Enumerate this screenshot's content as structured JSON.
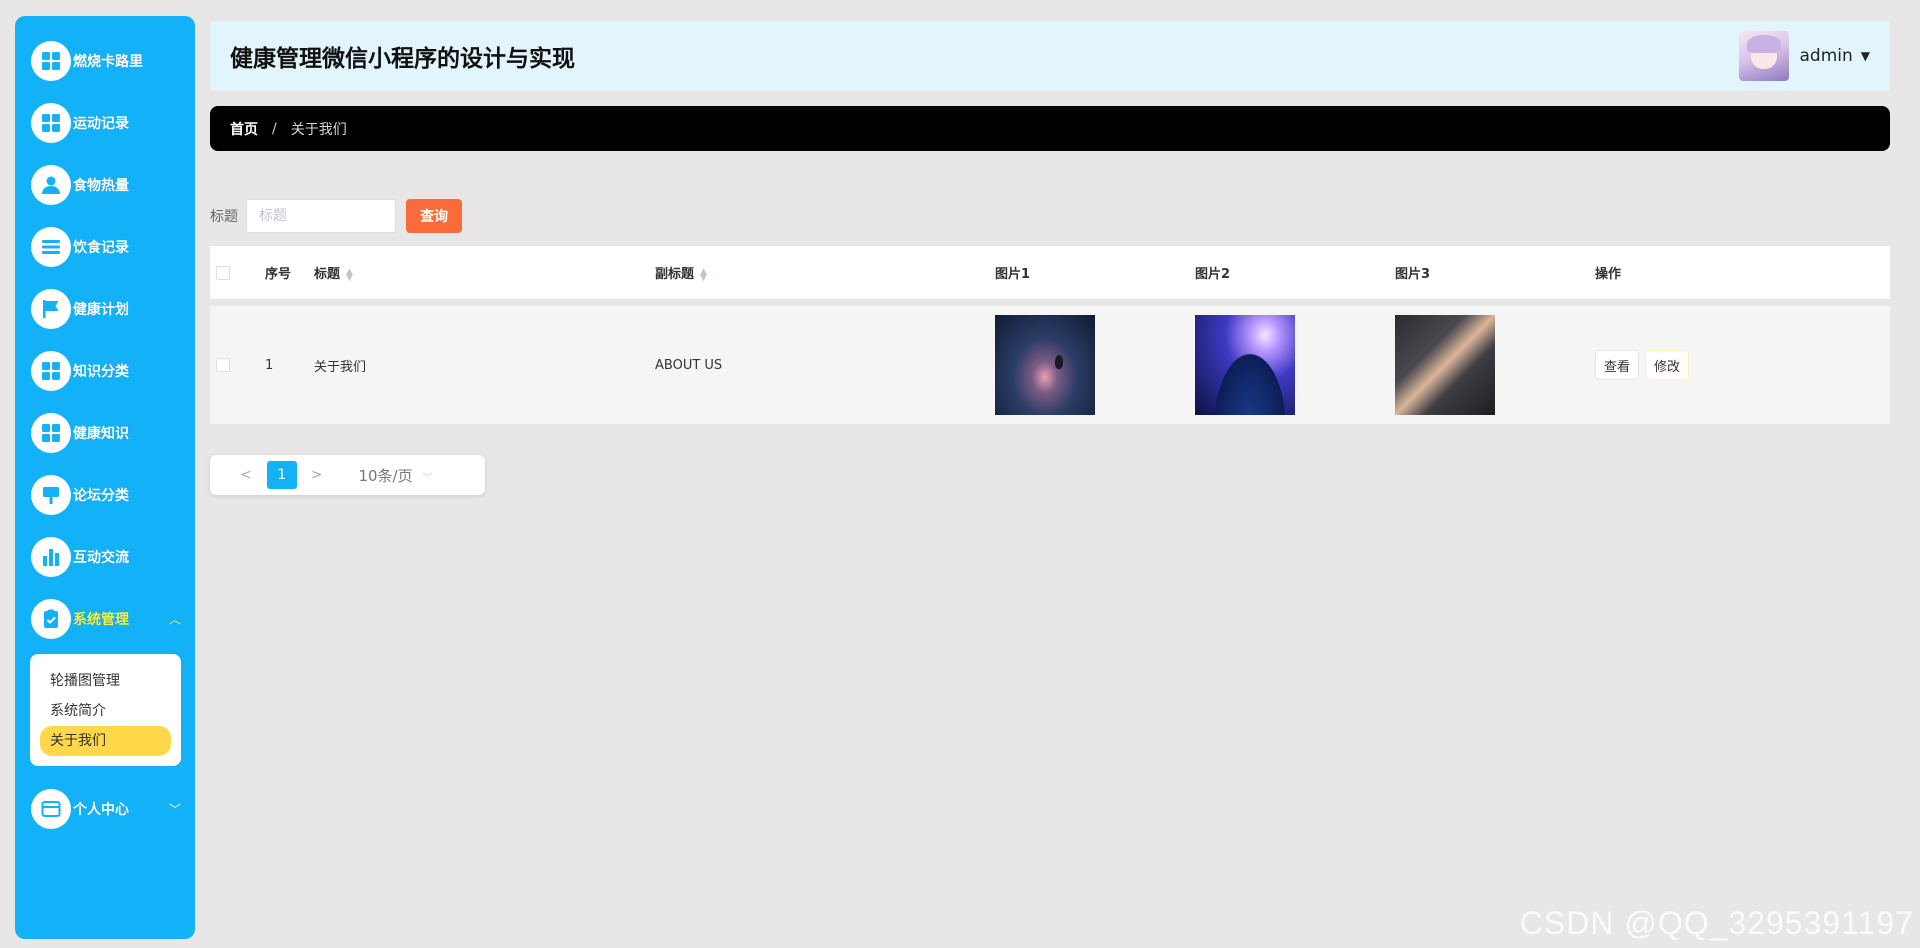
{
  "colors": {
    "sidebar": "#13b1f7",
    "active_nav": "#f6ef43",
    "submenu_active": "#ffd84a",
    "search_button": "#f96b3a",
    "page_active": "#13b1f7"
  },
  "sidebar": {
    "items": [
      {
        "label": "燃烧卡路里",
        "icon": "grid-icon"
      },
      {
        "label": "运动记录",
        "icon": "grid-icon"
      },
      {
        "label": "食物热量",
        "icon": "user-icon"
      },
      {
        "label": "饮食记录",
        "icon": "list-icon"
      },
      {
        "label": "健康计划",
        "icon": "flag-icon"
      },
      {
        "label": "知识分类",
        "icon": "grid-icon"
      },
      {
        "label": "健康知识",
        "icon": "grid-icon"
      },
      {
        "label": "论坛分类",
        "icon": "board-icon"
      },
      {
        "label": "互动交流",
        "icon": "bar-chart-icon"
      },
      {
        "label": "系统管理",
        "icon": "clipboard-check-icon",
        "expanded": true
      },
      {
        "label": "个人中心",
        "icon": "wallet-icon",
        "expanded": false
      }
    ],
    "submenu": [
      "轮播图管理",
      "系统简介",
      "关于我们"
    ]
  },
  "header": {
    "title": "健康管理微信小程序的设计与实现",
    "user": "admin"
  },
  "breadcrumb": {
    "home": "首页",
    "separator": "/",
    "current": "关于我们"
  },
  "search": {
    "label": "标题",
    "placeholder": "标题",
    "button": "查询"
  },
  "table": {
    "columns": {
      "index": "序号",
      "title": "标题",
      "subtitle": "副标题",
      "img1": "图片1",
      "img2": "图片2",
      "img3": "图片3",
      "ops": "操作"
    },
    "rows": [
      {
        "index": "1",
        "title": "关于我们",
        "subtitle": "ABOUT US",
        "view": "查看",
        "edit": "修改"
      }
    ]
  },
  "pagination": {
    "prev": "<",
    "current": "1",
    "next": ">",
    "page_size": "10条/页"
  },
  "watermark": "CSDN @QQ_3295391197"
}
